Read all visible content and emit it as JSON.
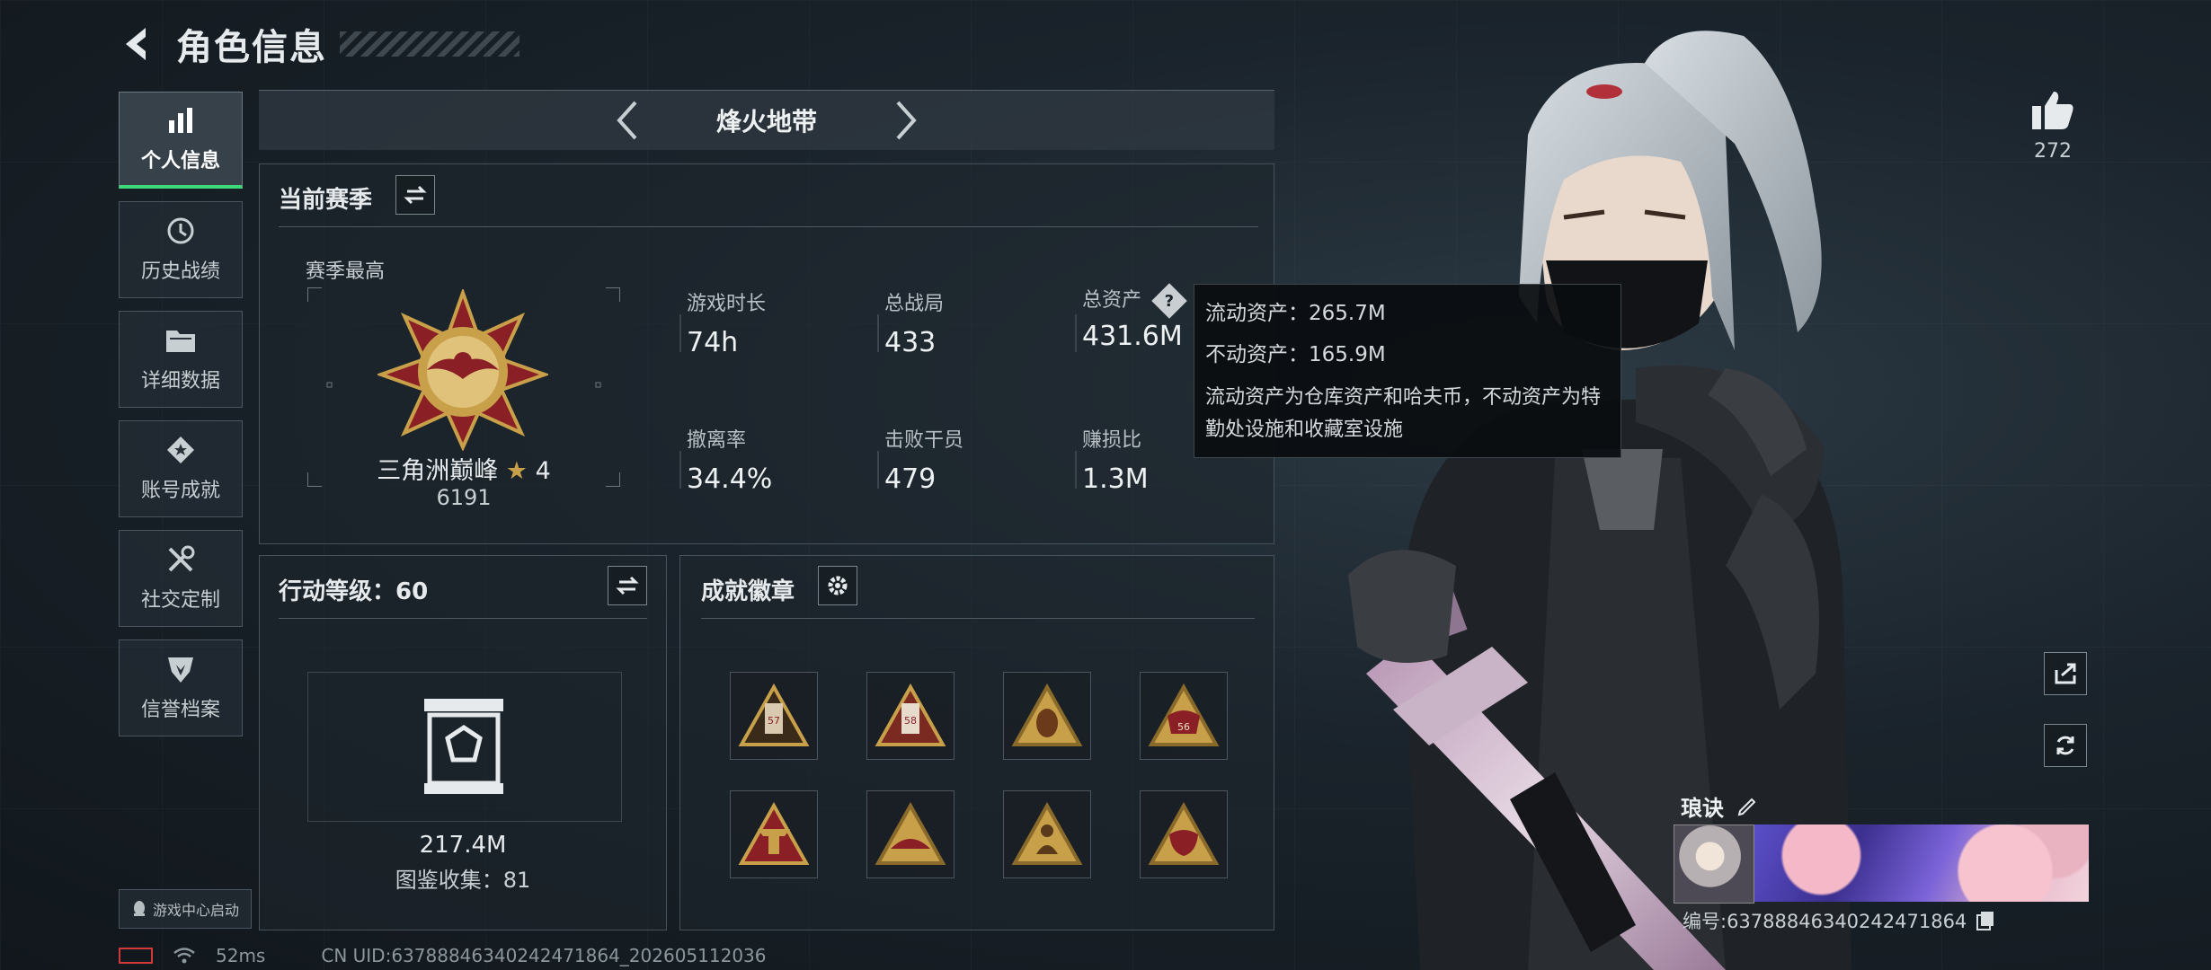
{
  "header": {
    "title": "角色信息"
  },
  "sidebar": {
    "items": [
      {
        "label": "个人信息",
        "icon": "bar-chart-icon",
        "active": true
      },
      {
        "label": "历史战绩",
        "icon": "history-icon",
        "active": false
      },
      {
        "label": "详细数据",
        "icon": "folder-icon",
        "active": false
      },
      {
        "label": "账号成就",
        "icon": "achievement-icon",
        "active": false
      },
      {
        "label": "社交定制",
        "icon": "tools-icon",
        "active": false
      },
      {
        "label": "信誉档案",
        "icon": "credit-shield-icon",
        "active": false
      }
    ],
    "launch_label": "游戏中心启动"
  },
  "mode": {
    "title": "烽火地带"
  },
  "season": {
    "title": "当前赛季",
    "best_label": "赛季最高",
    "rank_name": "三角洲巅峰",
    "rank_stars": "4",
    "rank_score": "6191",
    "stats": [
      {
        "label": "游戏时长",
        "value": "74h"
      },
      {
        "label": "总战局",
        "value": "433"
      },
      {
        "label": "总资产",
        "value": "431.6M"
      },
      {
        "label": "撤离率",
        "value": "34.4%"
      },
      {
        "label": "击败干员",
        "value": "479"
      },
      {
        "label": "赚损比",
        "value": "1.3M"
      }
    ]
  },
  "tooltip": {
    "liquid": "流动资产：265.7M",
    "fixed": "不动资产：165.9M",
    "description": "流动资产为仓库资产和哈夫币，不动资产为特勤处设施和收藏室设施"
  },
  "action_level": {
    "title": "行动等级：60",
    "vault_value": "217.4M",
    "collection": "图鉴收集：81"
  },
  "badges": {
    "title": "成就徽章",
    "items": [
      {
        "icon": "badge-tower-icon",
        "number": "57"
      },
      {
        "icon": "badge-tower-icon",
        "number": "58"
      },
      {
        "icon": "badge-lantern-icon",
        "number": ""
      },
      {
        "icon": "badge-bull-icon",
        "number": "56"
      },
      {
        "icon": "badge-crane-icon",
        "number": ""
      },
      {
        "icon": "badge-hat-icon",
        "number": ""
      },
      {
        "icon": "badge-figure-icon",
        "number": ""
      },
      {
        "icon": "badge-mask-icon",
        "number": ""
      }
    ]
  },
  "profile": {
    "likes": "272",
    "name": "琅诀",
    "id_text": "编号:6378884634024247186​4"
  },
  "status": {
    "ping": "52ms",
    "uid": "CN UID:6378884634024247186​4_202605112036"
  },
  "colors": {
    "accent_green": "#3ed97a",
    "medal_gold": "#c9a04a",
    "medal_red": "#8a1f25"
  }
}
